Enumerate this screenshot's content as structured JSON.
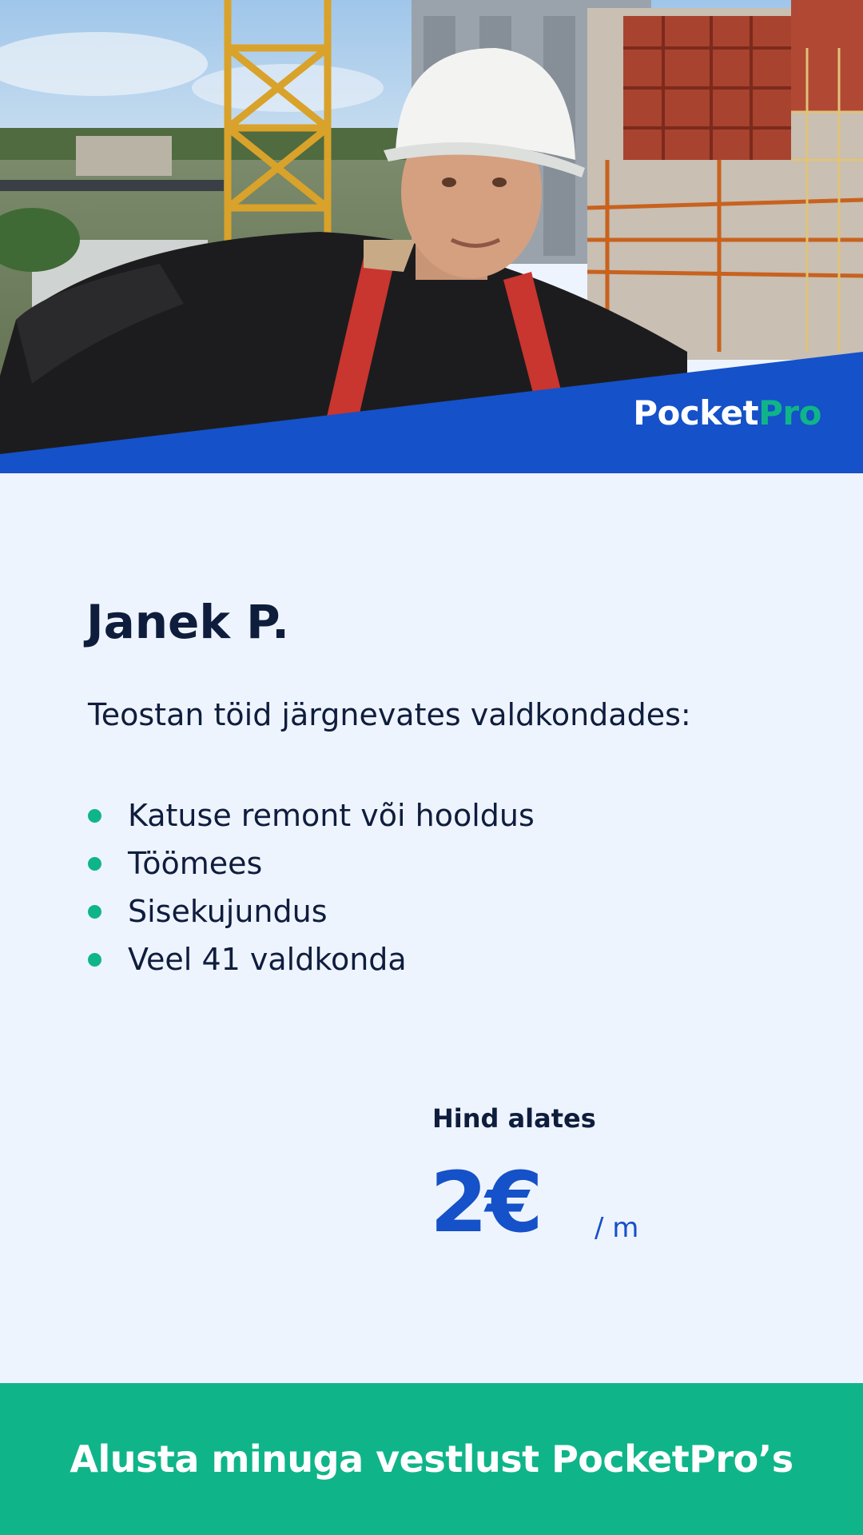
{
  "hero": {
    "photo_alt": "",
    "brand": {
      "part1": "Pocket",
      "part2": "Pro"
    }
  },
  "profile": {
    "name": "Janek P.",
    "intro": "Teostan töid järgnevates valdkondades:",
    "services": [
      "Katuse remont või hooldus",
      "Töömees",
      "Sisekujundus",
      "Veel 41 valdkonda"
    ]
  },
  "price": {
    "label": "Hind alates",
    "amount": "2€",
    "unit": "/ m"
  },
  "cta": {
    "label": "Alusta minuga vestlust PocketPro’s"
  },
  "colors": {
    "brand_blue": "#1551c8",
    "brand_green": "#0fb589",
    "background": "#eef4fe",
    "text_dark": "#0f1d3d"
  }
}
